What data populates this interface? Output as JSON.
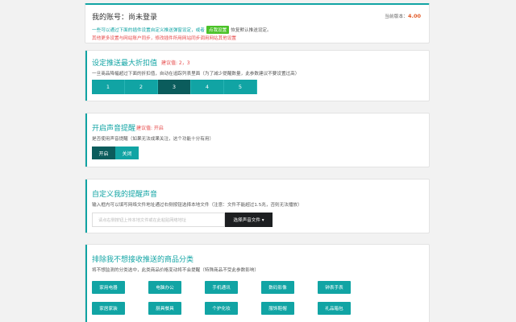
{
  "account": {
    "title": "我的账号：尚未登录",
    "version_label": "当前版本：",
    "version_value": "4.00",
    "line1_before": "一些可以通过下面的插件设置自定义推送弹窗设定，或者",
    "line1_pill": "点我设置",
    "line1_after": "恢复默认推送设定。",
    "line2": "其他更多设置与网站账户同步，修改插件所用网站同步调用网站其他设置"
  },
  "discount": {
    "title": "设定推送最大折扣值",
    "hint": "建议值: 2，3",
    "desc": "一旦商品降幅超过下面的折扣值，自动在追踪列表里面（为了减少提醒数量，此参数建议不要设置过高）",
    "options": [
      "1",
      "2",
      "3",
      "4",
      "5"
    ],
    "selected": "3"
  },
  "sound": {
    "title": "开启声音提醒",
    "hint": "建议值: 开启",
    "desc": "是否使用声音提醒（如果无法成果关注，这个功能十分有用）",
    "on_label": "开启",
    "off_label": "关闭",
    "selected": "开启"
  },
  "custom_sound": {
    "title": "自定义我的提醒声音",
    "desc": "输入框内可以填写网络文件地址通过右侧按钮选择本地文件（注意：文件不能超过1.5兆，否则无法播放）",
    "placeholder": "请点右侧按钮上传本地文件或在此粘贴网络地址",
    "button_label": "选择声音文件 ▾"
  },
  "categories": {
    "title": "排除我不想接收推送的商品分类",
    "desc": "将不想监测的分类选中，此类商品价格变动将不会提醒（特殊商品不受此参数影响）",
    "items": [
      "家用电器",
      "电脑办公",
      "手机通讯",
      "数码影像",
      "钟表手表",
      "家居家装",
      "厨具餐具",
      "个护化妆",
      "服饰鞋帽",
      "礼品箱包"
    ]
  }
}
